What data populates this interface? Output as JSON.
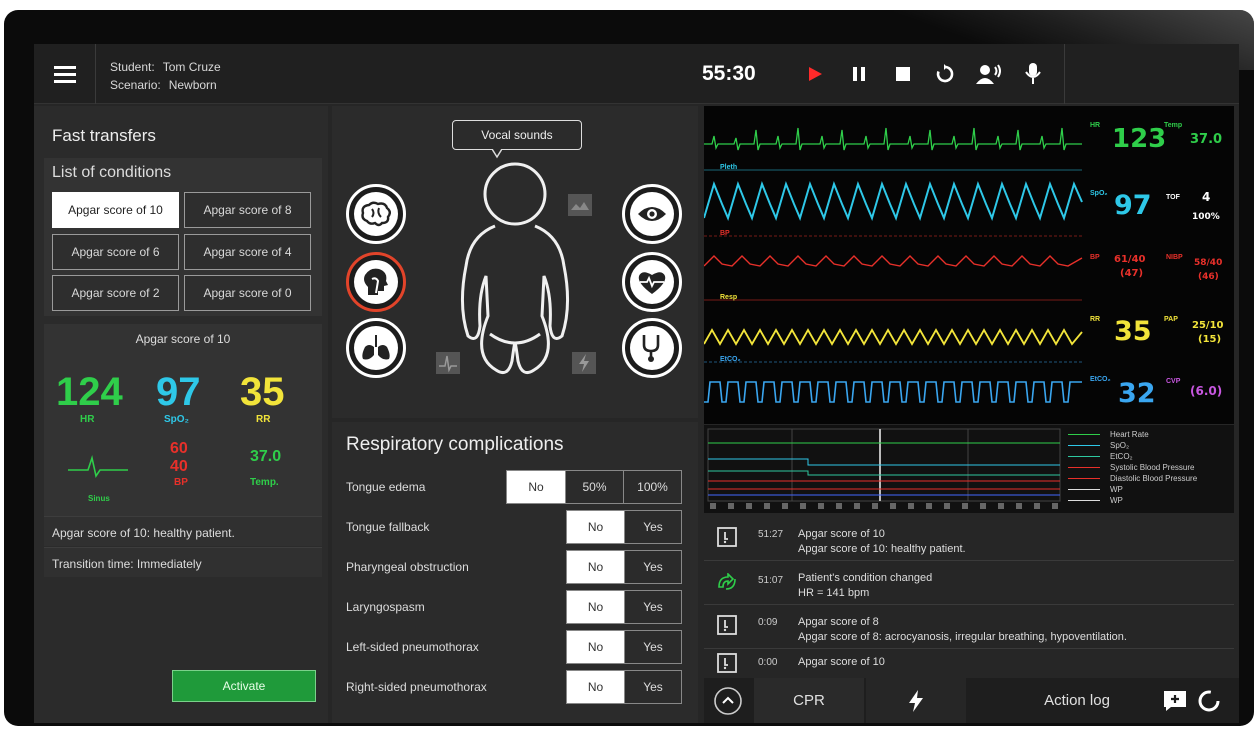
{
  "header": {
    "student_label": "Student:",
    "student_name": "Tom Cruze",
    "scenario_label": "Scenario:",
    "scenario_name": "Newborn",
    "timer": "55:30"
  },
  "left_panel": {
    "title": "Fast transfers",
    "conditions_title": "List of conditions",
    "conditions": [
      "Apgar score of 10",
      "Apgar score of 8",
      "Apgar score of 6",
      "Apgar score of 4",
      "Apgar score of 2",
      "Apgar score of 0"
    ],
    "selected_index": 0,
    "apgar": {
      "title": "Apgar score of 10",
      "hr": "124",
      "hr_label": "HR",
      "spo2": "97",
      "spo2_label": "SpO₂",
      "rr": "35",
      "rr_label": "RR",
      "sinus_label": "Sinus",
      "bp_sys": "60",
      "bp_dia": "40",
      "bp_label": "BP",
      "temp": "37.0",
      "temp_label": "Temp."
    },
    "description": "Apgar score of 10: healthy patient.",
    "transition": "Transition time: Immediately",
    "activate_label": "Activate"
  },
  "body_panel": {
    "vocal_sounds": "Vocal sounds"
  },
  "respiratory": {
    "title": "Respiratory complications",
    "rows": [
      {
        "label": "Tongue edema",
        "options": [
          "No",
          "50%",
          "100%"
        ],
        "selected": 0
      },
      {
        "label": "Tongue fallback",
        "options": [
          "No",
          "Yes"
        ],
        "selected": 0
      },
      {
        "label": "Pharyngeal obstruction",
        "options": [
          "No",
          "Yes"
        ],
        "selected": 0
      },
      {
        "label": "Laryngospasm",
        "options": [
          "No",
          "Yes"
        ],
        "selected": 0
      },
      {
        "label": "Left-sided pneumothorax",
        "options": [
          "No",
          "Yes"
        ],
        "selected": 0
      },
      {
        "label": "Right-sided pneumothorax",
        "options": [
          "No",
          "Yes"
        ],
        "selected": 0
      }
    ]
  },
  "monitor": {
    "hr_label": "HR",
    "hr": "123",
    "temp_label": "Temp",
    "temp": "37.0",
    "pleth_label": "Pleth",
    "spo2_label": "SpO₂",
    "spo2": "97",
    "tof_label": "TOF",
    "tof": "4",
    "tof_pct": "100%",
    "bp_wave_label": "BP",
    "bp_label": "BP",
    "bp": "61/40",
    "bp_mean": "(47)",
    "nibp_label": "NIBP",
    "nibp": "58/40",
    "nibp_mean": "(46)",
    "resp_wave_label": "Resp",
    "rr_label": "RR",
    "rr": "35",
    "pap_label": "PAP",
    "pap": "25/10",
    "pap_mean": "(15)",
    "etco2_wave_label": "EtCO₂",
    "etco2_label": "EtCO₂",
    "etco2": "32",
    "cvp_label": "CVP",
    "cvp": "(6.0)",
    "colors": {
      "hr": "#2fce4a",
      "spo2": "#2ec8e8",
      "bp": "#e8302a",
      "rr": "#f2e43a",
      "etco2": "#3aa6f0",
      "cvp": "#c857e0",
      "tof": "#ffffff"
    }
  },
  "trend": {
    "legend": [
      "Heart Rate",
      "SpO₂",
      "EtCO₂",
      "Systolic Blood Pressure",
      "Diastolic Blood Pressure",
      "WP",
      "WP"
    ],
    "colors": [
      "#2fce4a",
      "#2ec8e8",
      "#2ec8a0",
      "#e8302a",
      "#e8302a",
      "#dddddd",
      "#dddddd"
    ]
  },
  "log": {
    "entries": [
      {
        "icon": "note-icon",
        "time": "51:27",
        "line1": "Apgar score of 10",
        "line2": "Apgar score of 10: healthy patient."
      },
      {
        "icon": "condition-change-icon",
        "time": "51:07",
        "line1": "Patient's condition changed",
        "line2": "HR = 141 bpm"
      },
      {
        "icon": "note-icon",
        "time": "0:09",
        "line1": "Apgar score of 8",
        "line2": "Apgar score of 8: acrocyanosis, irregular breathing, hypoventilation."
      },
      {
        "icon": "note-icon",
        "time": "0:00",
        "line1": "Apgar score of 10",
        "line2": ""
      }
    ]
  },
  "bottom_bar": {
    "cpr_label": "CPR",
    "action_log_label": "Action log"
  }
}
